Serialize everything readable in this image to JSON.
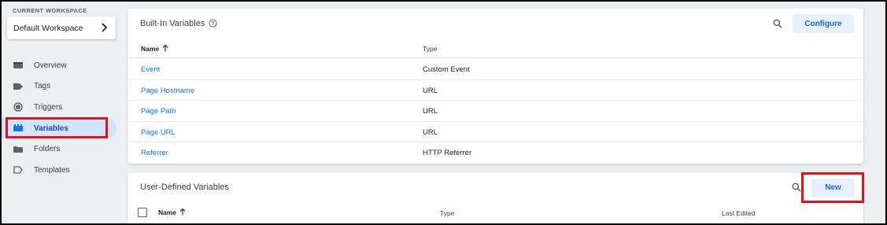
{
  "sidebar": {
    "workspace_label": "CURRENT WORKSPACE",
    "workspace_name": "Default Workspace",
    "items": [
      {
        "label": "Overview",
        "icon": "overview-icon"
      },
      {
        "label": "Tags",
        "icon": "tag-icon"
      },
      {
        "label": "Triggers",
        "icon": "trigger-icon"
      },
      {
        "label": "Variables",
        "icon": "variables-icon",
        "active": true
      },
      {
        "label": "Folders",
        "icon": "folder-icon"
      },
      {
        "label": "Templates",
        "icon": "template-icon"
      }
    ]
  },
  "builtin": {
    "title": "Built-In Variables",
    "configure_label": "Configure",
    "columns": {
      "name": "Name",
      "type": "Type"
    },
    "rows": [
      {
        "name": "Event",
        "type": "Custom Event"
      },
      {
        "name": "Page Hostname",
        "type": "URL"
      },
      {
        "name": "Page Path",
        "type": "URL"
      },
      {
        "name": "Page URL",
        "type": "URL"
      },
      {
        "name": "Referrer",
        "type": "HTTP Referrer"
      }
    ]
  },
  "user_defined": {
    "title": "User-Defined Variables",
    "new_label": "New",
    "columns": {
      "name": "Name",
      "type": "Type",
      "last_edited": "Last Edited"
    }
  },
  "colors": {
    "accent": "#1a73e8",
    "active_bg": "#d2e3fc",
    "highlight": "#e3111b"
  }
}
